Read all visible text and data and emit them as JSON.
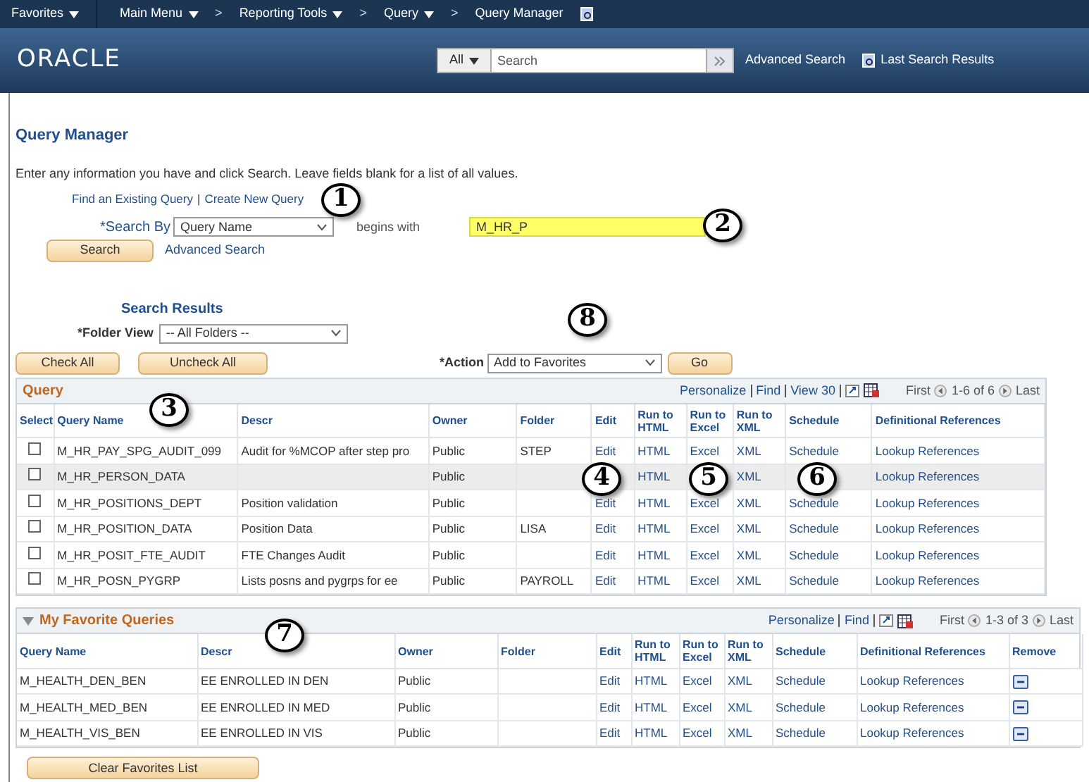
{
  "nav": {
    "items": [
      {
        "label": "Favorites",
        "dropdown": true
      },
      {
        "label": "Main Menu",
        "dropdown": true
      },
      {
        "label": "Reporting Tools",
        "dropdown": true,
        "separator": ">"
      },
      {
        "label": "Query",
        "dropdown": true,
        "separator": ">"
      },
      {
        "label": "Query Manager",
        "dropdown": false,
        "separator": ">"
      }
    ]
  },
  "header": {
    "logo": "ORACLE",
    "scope": "All",
    "search_placeholder": "Search",
    "links": [
      "Advanced Search",
      "Last Search Results"
    ]
  },
  "page": {
    "title": "Query Manager",
    "instructions": "Enter any information you have and click Search. Leave fields blank for a list of all values.",
    "links": [
      "Find an Existing Query",
      "Create New Query"
    ],
    "link_separator": "|",
    "search_by": {
      "label": "*Search By",
      "value": "Query Name",
      "operator": "begins with",
      "term": "M_HR_P",
      "highlighted": true
    },
    "search_button": "Search",
    "advanced_link": "Advanced Search",
    "results_title": "Search Results",
    "folder_view": {
      "label": "*Folder View",
      "value": "-- All Folders --"
    },
    "check_buttons": [
      "Check All",
      "Uncheck All"
    ],
    "action": {
      "label": "*Action",
      "value": "Add to Favorites",
      "button": "Go"
    }
  },
  "query_grid": {
    "title": "Query",
    "toolbar": [
      "Personalize",
      "Find",
      "View 30"
    ],
    "first": "First",
    "range": "1-6 of 6",
    "last": "Last",
    "columns": [
      {
        "label": "Select",
        "kind": "checkbox"
      },
      {
        "label": "Query Name",
        "kind": "text"
      },
      {
        "label": "Descr",
        "kind": "text"
      },
      {
        "label": "Owner",
        "kind": "text"
      },
      {
        "label": "Folder",
        "kind": "text"
      },
      {
        "label": "Edit",
        "kind": "link"
      },
      {
        "label": "Run to HTML",
        "kind": "link"
      },
      {
        "label": "Run to Excel",
        "kind": "link"
      },
      {
        "label": "Run to XML",
        "kind": "link"
      },
      {
        "label": "Schedule",
        "kind": "link"
      },
      {
        "label": "Definitional References",
        "kind": "link"
      }
    ],
    "rows": [
      {
        "checked": false,
        "highlighted": false,
        "cells": [
          null,
          "M_HR_PAY_SPG_AUDIT_099",
          "Audit for %MCOP after step pro",
          "Public",
          "STEP",
          "Edit",
          "HTML",
          "Excel",
          "XML",
          "Schedule",
          "Lookup References"
        ]
      },
      {
        "checked": false,
        "highlighted": true,
        "cells": [
          null,
          "M_HR_PERSON_DATA",
          null,
          "Public",
          null,
          null,
          "HTML",
          null,
          "XML",
          null,
          "Lookup References"
        ]
      },
      {
        "checked": false,
        "highlighted": false,
        "cells": [
          null,
          "M_HR_POSITIONS_DEPT",
          "Position validation",
          "Public",
          null,
          "Edit",
          "HTML",
          "Excel",
          "XML",
          "Schedule",
          "Lookup References"
        ]
      },
      {
        "checked": false,
        "highlighted": false,
        "cells": [
          null,
          "M_HR_POSITION_DATA",
          "Position Data",
          "Public",
          "LISA",
          "Edit",
          "HTML",
          "Excel",
          "XML",
          "Schedule",
          "Lookup References"
        ]
      },
      {
        "checked": false,
        "highlighted": false,
        "cells": [
          null,
          "M_HR_POSIT_FTE_AUDIT",
          "FTE Changes Audit",
          "Public",
          null,
          "Edit",
          "HTML",
          "Excel",
          "XML",
          "Schedule",
          "Lookup References"
        ]
      },
      {
        "checked": false,
        "highlighted": false,
        "cells": [
          null,
          "M_HR_POSN_PYGRP",
          "Lists posns and pygrps for ee",
          "Public",
          "PAYROLL",
          "Edit",
          "HTML",
          "Excel",
          "XML",
          "Schedule",
          "Lookup References"
        ]
      }
    ]
  },
  "favorites_grid": {
    "title": "My Favorite Queries",
    "expanded": true,
    "toolbar": [
      "Personalize",
      "Find"
    ],
    "first": "First",
    "range": "1-3 of 3",
    "last": "Last",
    "columns": [
      {
        "label": "Query Name",
        "kind": "text"
      },
      {
        "label": "Descr",
        "kind": "text"
      },
      {
        "label": "Owner",
        "kind": "text"
      },
      {
        "label": "Folder",
        "kind": "text"
      },
      {
        "label": "Edit",
        "kind": "link"
      },
      {
        "label": "Run to HTML",
        "kind": "link"
      },
      {
        "label": "Run to Excel",
        "kind": "link"
      },
      {
        "label": "Run to XML",
        "kind": "link"
      },
      {
        "label": "Schedule",
        "kind": "link"
      },
      {
        "label": "Definitional References",
        "kind": "link"
      },
      {
        "label": "Remove",
        "kind": "icon"
      }
    ],
    "rows": [
      {
        "highlighted": false,
        "cells": [
          "M_HEALTH_DEN_BEN",
          "EE ENROLLED IN DEN",
          "Public",
          null,
          "Edit",
          "HTML",
          "Excel",
          "XML",
          "Schedule",
          "Lookup References",
          null
        ]
      },
      {
        "highlighted": false,
        "cells": [
          "M_HEALTH_MED_BEN",
          "EE ENROLLED IN MED",
          "Public",
          null,
          "Edit",
          "HTML",
          "Excel",
          "XML",
          "Schedule",
          "Lookup References",
          null
        ]
      },
      {
        "highlighted": false,
        "cells": [
          "M_HEALTH_VIS_BEN",
          "EE ENROLLED IN VIS",
          "Public",
          null,
          "Edit",
          "HTML",
          "Excel",
          "XML",
          "Schedule",
          "Lookup References",
          null
        ]
      }
    ]
  },
  "clear_button": "Clear Favorites List",
  "callouts": [
    "1",
    "2",
    "3",
    "4",
    "5",
    "6",
    "7",
    "8"
  ]
}
